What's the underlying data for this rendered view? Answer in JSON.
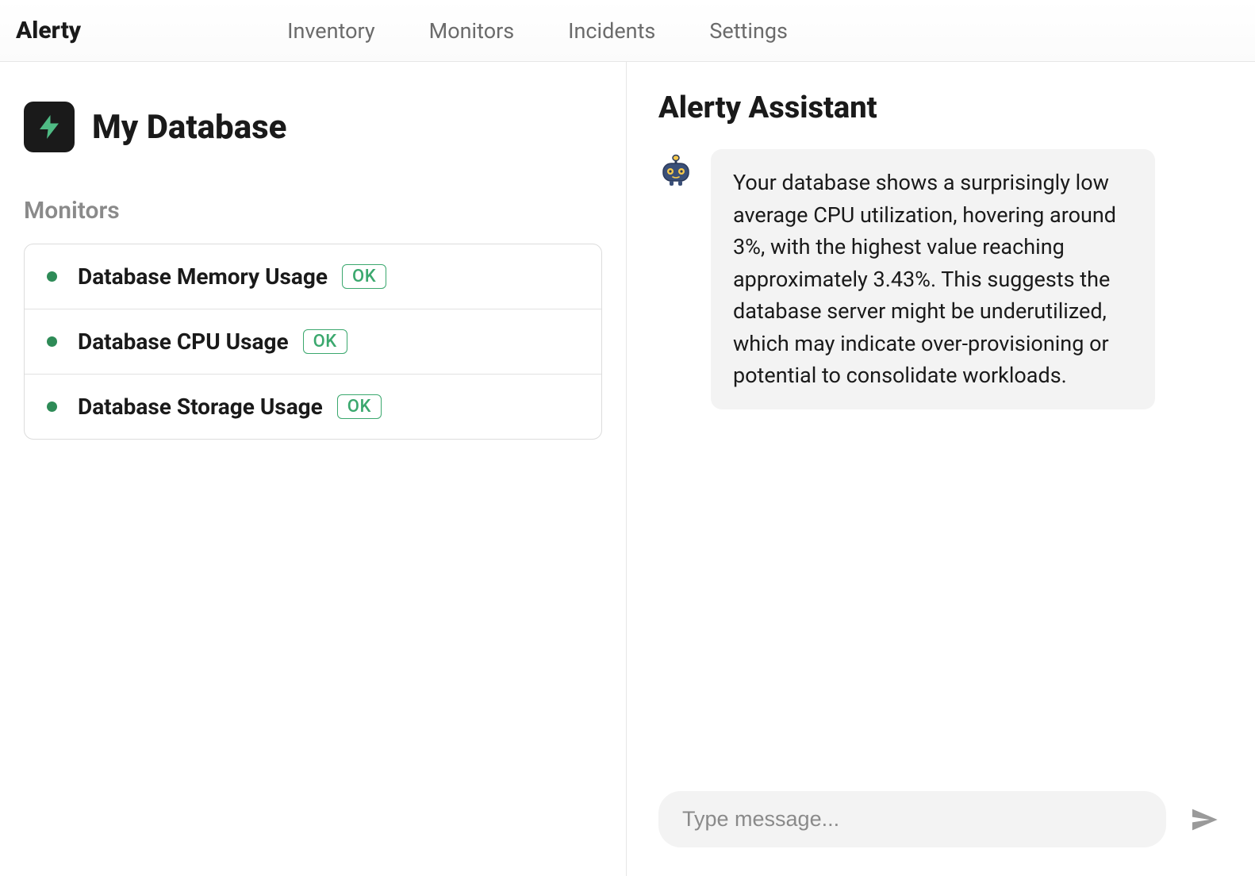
{
  "header": {
    "brand": "Alerty",
    "nav": [
      "Inventory",
      "Monitors",
      "Incidents",
      "Settings"
    ]
  },
  "resource": {
    "title": "My Database"
  },
  "monitors": {
    "section_label": "Monitors",
    "items": [
      {
        "name": "Database Memory Usage",
        "status": "OK"
      },
      {
        "name": "Database CPU Usage",
        "status": "OK"
      },
      {
        "name": "Database Storage Usage",
        "status": "OK"
      }
    ]
  },
  "assistant": {
    "title": "Alerty Assistant",
    "messages": [
      {
        "role": "assistant",
        "text": "Your database shows a surprisingly low average CPU utilization, hovering around 3%, with the highest value reaching approximately 3.43%. This suggests the database server might be underutilized, which may indicate over-provisioning or potential to consolidate workloads."
      }
    ],
    "input_placeholder": "Type message..."
  }
}
